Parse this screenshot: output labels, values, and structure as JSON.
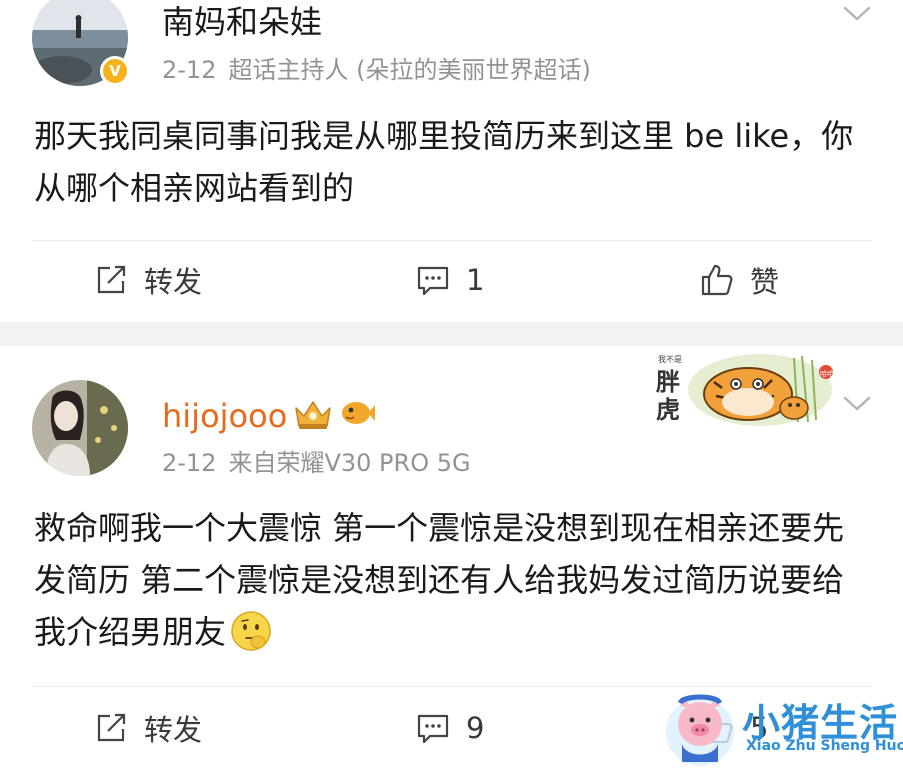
{
  "posts": [
    {
      "username": "南妈和朵娃",
      "date": "2-12",
      "role": "超话主持人 (朵拉的美丽世界超话)",
      "content": "那天我同桌同事问我是从哪里投简历来到这里 be like，你从哪个相亲网站看到的",
      "actions": {
        "repost": "转发",
        "comment_count": "1",
        "like": "赞"
      }
    },
    {
      "username": "hijojooo",
      "date": "2-12",
      "source_prefix": "来自",
      "source_device": "荣耀V30 PRO 5G",
      "content": "救命啊我一个大震惊 第一个震惊是没想到现在相亲还要先发简历 第二个震惊是没想到还有人给我妈发过简历说要给我介绍男朋友",
      "actions": {
        "repost": "转发",
        "comment_count": "9",
        "like_count": "5"
      }
    }
  ],
  "sticker": {
    "big_text": "胖虎",
    "small_text": "我不是",
    "seal_text": "哈哈"
  },
  "watermark": {
    "title": "小猪生活",
    "subtitle": "Xiao Zhu Sheng Huo"
  },
  "colors": {
    "meta_gray": "#939393",
    "badge_gold": "#f6b21b",
    "username_orange": "#e86a1a",
    "separator": "#f2f2f2"
  },
  "icons": [
    "chevron-down-icon",
    "repost-icon",
    "comment-icon",
    "like-icon",
    "verified-badge-icon",
    "crown-badge-icon",
    "fish-badge-icon",
    "thinking-emoji-icon"
  ]
}
